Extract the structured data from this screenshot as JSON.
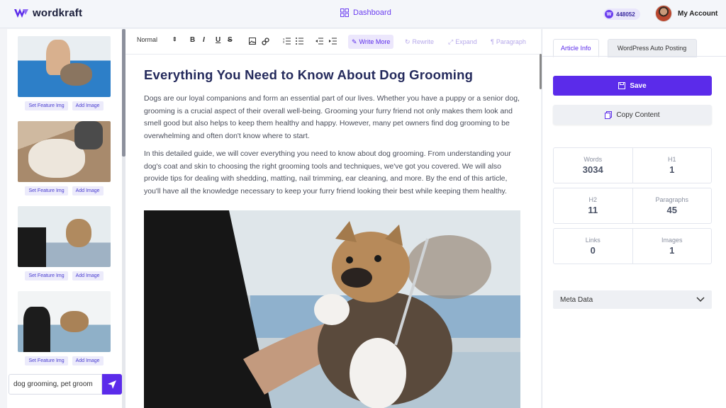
{
  "app": {
    "name": "wordkraft"
  },
  "header": {
    "dashboard_label": "Dashboard",
    "credits": "448052",
    "credits_badge": "W",
    "account_label": "My Account"
  },
  "sidebar": {
    "images": [
      {
        "set_feature_label": "Set Feature Img",
        "add_image_label": "Add Image"
      },
      {
        "set_feature_label": "Set Feature Img",
        "add_image_label": "Add Image"
      },
      {
        "set_feature_label": "Set Feature Img",
        "add_image_label": "Add Image"
      },
      {
        "set_feature_label": "Set Feature Img",
        "add_image_label": "Add Image"
      }
    ],
    "keyword_value": "dog grooming, pet groom"
  },
  "toolbar": {
    "format_label": "Normal",
    "write_more_label": "Write More",
    "rewrite_label": "Rewrite",
    "expand_label": "Expand",
    "paragraph_label": "Paragraph"
  },
  "article": {
    "title": "Everything You Need to Know About Dog Grooming",
    "paragraphs": [
      "Dogs are our loyal companions and form an essential part of our lives. Whether you have a puppy or a senior dog, grooming is a crucial aspect of their overall well-being. Grooming your furry friend not only makes them look and smell good but also helps to keep them healthy and happy. However, many pet owners find dog grooming to be overwhelming and often don't know where to start.",
      "In this detailed guide, we will cover everything you need to know about dog grooming. From understanding your dog's coat and skin to choosing the right grooming tools and techniques, we've got you covered. We will also provide tips for dealing with shedding, matting, nail trimming, ear cleaning, and more. By the end of this article, you'll have all the knowledge necessary to keep your furry friend looking their best while keeping them healthy."
    ]
  },
  "panel": {
    "tabs": [
      "Article Info",
      "WordPress Auto Posting"
    ],
    "save_label": "Save",
    "copy_label": "Copy Content",
    "stats": [
      {
        "label": "Words",
        "value": "3034"
      },
      {
        "label": "H1",
        "value": "1"
      },
      {
        "label": "H2",
        "value": "11"
      },
      {
        "label": "Paragraphs",
        "value": "45"
      },
      {
        "label": "Links",
        "value": "0"
      },
      {
        "label": "Images",
        "value": "1"
      }
    ],
    "meta_label": "Meta Data"
  },
  "colors": {
    "accent": "#5b2bea",
    "title": "#242a5c"
  }
}
